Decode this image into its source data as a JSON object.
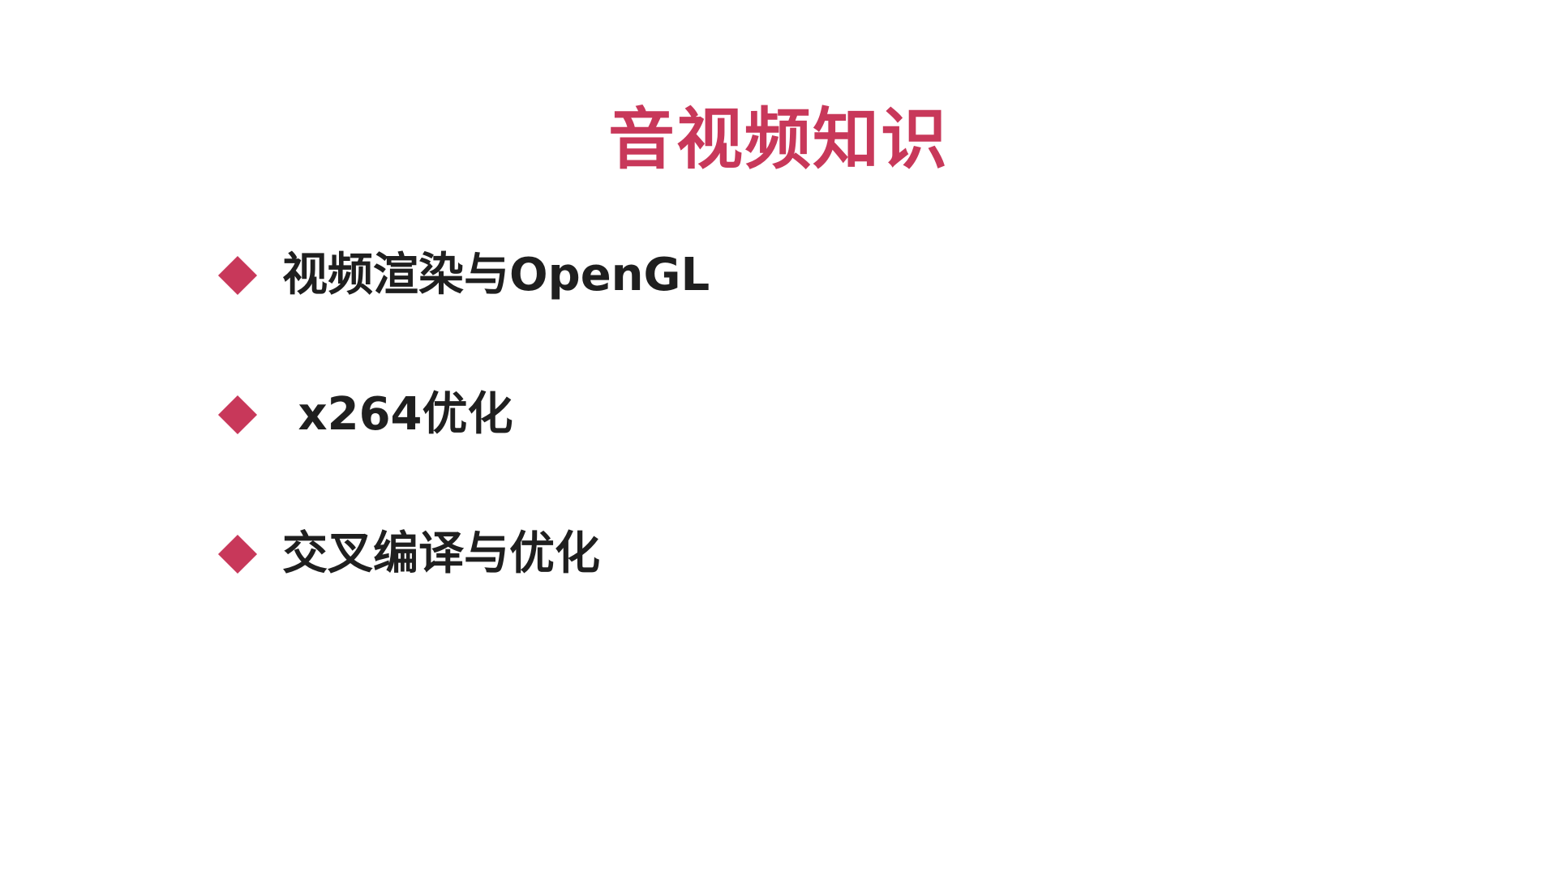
{
  "slide": {
    "title": "音视频知识",
    "bullets": [
      {
        "text": "视频渲染与OpenGL"
      },
      {
        "text": " x264优化"
      },
      {
        "text": "交叉编译与优化"
      }
    ]
  },
  "colors": {
    "accent": "#c8385a",
    "text": "#1f1f1f",
    "background": "#ffffff"
  },
  "icons": {
    "bullet": "diamond-icon"
  }
}
